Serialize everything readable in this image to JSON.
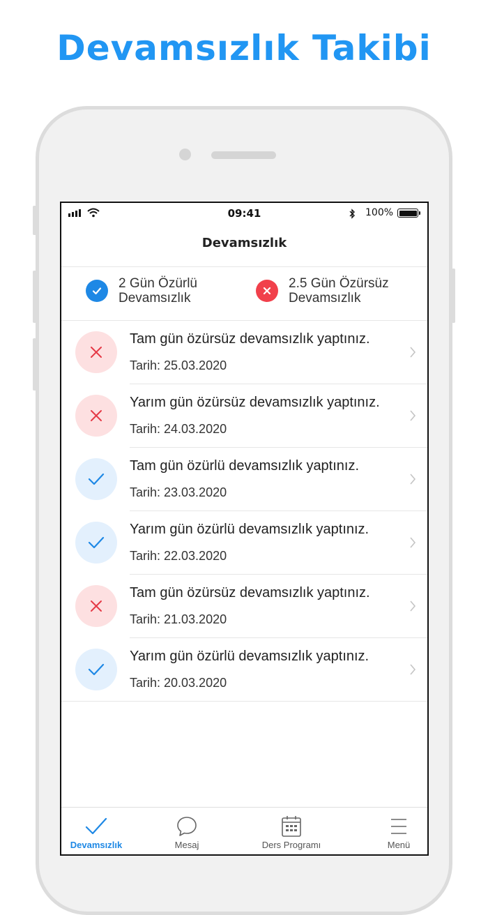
{
  "headline": "Devamsızlık Takibi",
  "status_bar": {
    "time": "09:41",
    "battery_percent": "100%",
    "bluetooth_icon": "bluetooth-icon"
  },
  "nav": {
    "title": "Devamsızlık"
  },
  "summary": {
    "excused": {
      "line1": "2 Gün Özürlü",
      "line2": "Devamsızlık",
      "icon": "check-icon",
      "color": "#1e88e5"
    },
    "unexcused": {
      "line1": "2.5 Gün Özürsüz",
      "line2": "Devamsızlık",
      "icon": "close-icon",
      "color": "#f1404b"
    }
  },
  "records": [
    {
      "title": "Tam gün özürsüz devamsızlık yaptınız.",
      "date": "Tarih: 25.03.2020",
      "status": "unexcused"
    },
    {
      "title": "Yarım gün özürsüz devamsızlık yaptınız.",
      "date": "Tarih: 24.03.2020",
      "status": "unexcused"
    },
    {
      "title": "Tam gün özürlü devamsızlık yaptınız.",
      "date": "Tarih: 23.03.2020",
      "status": "excused"
    },
    {
      "title": "Yarım gün özürlü devamsızlık yaptınız.",
      "date": "Tarih: 22.03.2020",
      "status": "excused"
    },
    {
      "title": "Tam gün özürsüz devamsızlık yaptınız.",
      "date": "Tarih: 21.03.2020",
      "status": "unexcused"
    },
    {
      "title": "Yarım gün özürlü devamsızlık yaptınız.",
      "date": "Tarih: 20.03.2020",
      "status": "excused"
    }
  ],
  "tabs": [
    {
      "label": "Devamsızlık",
      "icon": "check-icon",
      "active": true
    },
    {
      "label": "Mesaj",
      "icon": "chat-bubble-icon",
      "active": false
    },
    {
      "label": "Ders Programı",
      "icon": "calendar-icon",
      "active": false
    },
    {
      "label": "Menü",
      "icon": "hamburger-menu-icon",
      "active": false
    }
  ],
  "colors": {
    "accent": "#2196f3",
    "excused_bg": "#e3f0fd",
    "excused_fg": "#1e88e5",
    "unexcused_bg": "#fde0e1",
    "unexcused_fg": "#e53946"
  }
}
